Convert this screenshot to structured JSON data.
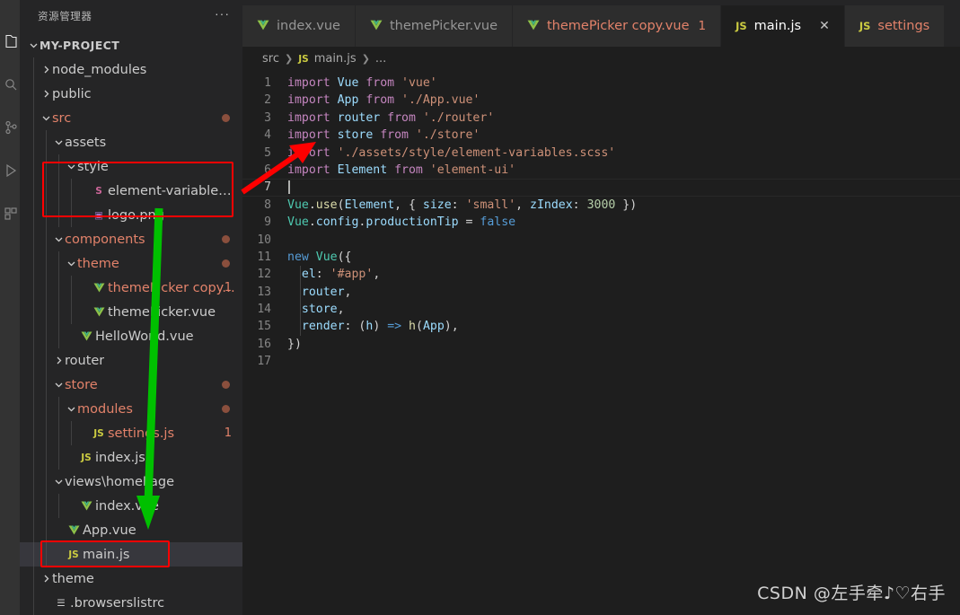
{
  "colors": {
    "accent_red": "#fe0000",
    "accent_green": "#00c000",
    "modified_file": "#e2826a",
    "editor_bg": "#1e1e1e",
    "sidebar_bg": "#252526",
    "tab_inactive_bg": "#2d2d2d"
  },
  "activity_bar": {
    "items": [
      {
        "name": "explorer-icon",
        "glyph": "files"
      },
      {
        "name": "search-icon",
        "glyph": "search"
      },
      {
        "name": "source-control-icon",
        "glyph": "branch"
      },
      {
        "name": "run-debug-icon",
        "glyph": "play"
      },
      {
        "name": "extensions-icon",
        "glyph": "blocks"
      }
    ]
  },
  "sidebar": {
    "title": "资源管理器",
    "more_actions": "···",
    "tree": [
      {
        "label": "MY-PROJECT",
        "kind": "root",
        "twisty": "down",
        "indent": 0,
        "color": "root"
      },
      {
        "label": "node_modules",
        "kind": "folder",
        "twisty": "right",
        "indent": 1,
        "color": "norm"
      },
      {
        "label": "public",
        "kind": "folder",
        "twisty": "right",
        "indent": 1,
        "color": "norm"
      },
      {
        "label": "src",
        "kind": "folder",
        "twisty": "down",
        "indent": 1,
        "color": "mod",
        "dot": true
      },
      {
        "label": "assets",
        "kind": "folder",
        "twisty": "down",
        "indent": 2,
        "color": "norm"
      },
      {
        "label": "style",
        "kind": "folder",
        "twisty": "down",
        "indent": 3,
        "color": "norm"
      },
      {
        "label": "element-variables.scss",
        "kind": "scss",
        "icon": "S",
        "indent": 4,
        "color": "norm"
      },
      {
        "label": "logo.png",
        "kind": "image",
        "icon": "▣",
        "indent": 4,
        "color": "norm"
      },
      {
        "label": "components",
        "kind": "folder",
        "twisty": "down",
        "indent": 2,
        "color": "mod",
        "dot": true
      },
      {
        "label": "theme",
        "kind": "folder",
        "twisty": "down",
        "indent": 3,
        "color": "mod",
        "dot": true
      },
      {
        "label": "themePicker copy.vue",
        "kind": "vue",
        "icon": "V",
        "indent": 4,
        "color": "mod",
        "count": "1"
      },
      {
        "label": "themePicker.vue",
        "kind": "vue",
        "icon": "V",
        "indent": 4,
        "color": "norm"
      },
      {
        "label": "HelloWorld.vue",
        "kind": "vue",
        "icon": "V",
        "indent": 3,
        "color": "norm"
      },
      {
        "label": "router",
        "kind": "folder",
        "twisty": "right",
        "indent": 2,
        "color": "norm"
      },
      {
        "label": "store",
        "kind": "folder",
        "twisty": "down",
        "indent": 2,
        "color": "mod",
        "dot": true
      },
      {
        "label": "modules",
        "kind": "folder",
        "twisty": "down",
        "indent": 3,
        "color": "mod",
        "dot": true
      },
      {
        "label": "settings.js",
        "kind": "js",
        "icon": "JS",
        "indent": 4,
        "color": "mod",
        "count": "1"
      },
      {
        "label": "index.js",
        "kind": "js",
        "icon": "JS",
        "indent": 3,
        "color": "norm"
      },
      {
        "label": "views\\homePage",
        "kind": "folder",
        "twisty": "down",
        "indent": 2,
        "color": "norm"
      },
      {
        "label": "index.vue",
        "kind": "vue",
        "icon": "V",
        "indent": 3,
        "color": "norm"
      },
      {
        "label": "App.vue",
        "kind": "vue",
        "icon": "V",
        "indent": 2,
        "color": "norm"
      },
      {
        "label": "main.js",
        "kind": "js",
        "icon": "JS",
        "indent": 2,
        "color": "norm",
        "selected": true
      },
      {
        "label": "theme",
        "kind": "folder",
        "twisty": "right",
        "indent": 1,
        "color": "norm"
      },
      {
        "label": ".browserslistrc",
        "kind": "text",
        "icon": "☰",
        "indent": 1,
        "color": "norm"
      }
    ]
  },
  "tabs": [
    {
      "label": "index.vue",
      "icon": "V",
      "icon_kind": "vue",
      "active": false,
      "modified": false
    },
    {
      "label": "themePicker.vue",
      "icon": "V",
      "icon_kind": "vue",
      "active": false,
      "modified": false
    },
    {
      "label": "themePicker copy.vue",
      "icon": "V",
      "icon_kind": "vue",
      "active": false,
      "modified": true,
      "count": "1"
    },
    {
      "label": "main.js",
      "icon": "JS",
      "icon_kind": "js",
      "active": true,
      "modified": false,
      "close": "✕"
    },
    {
      "label": "settings",
      "icon": "JS",
      "icon_kind": "js",
      "active": false,
      "modified": true
    }
  ],
  "breadcrumb": {
    "part1": "src",
    "sep": "❯",
    "file_icon": "JS",
    "file": "main.js",
    "sep2": "❯",
    "ellipsis": "..."
  },
  "editor": {
    "filename": "main.js",
    "cursor_line": 7,
    "lines": [
      {
        "n": "1",
        "tokens": [
          {
            "t": "import ",
            "c": "kw"
          },
          {
            "t": "Vue",
            "c": "var"
          },
          {
            "t": " from ",
            "c": "kw"
          },
          {
            "t": "'vue'",
            "c": "str"
          }
        ]
      },
      {
        "n": "2",
        "tokens": [
          {
            "t": "import ",
            "c": "kw"
          },
          {
            "t": "App",
            "c": "var"
          },
          {
            "t": " from ",
            "c": "kw"
          },
          {
            "t": "'./App.vue'",
            "c": "str"
          }
        ]
      },
      {
        "n": "3",
        "tokens": [
          {
            "t": "import ",
            "c": "kw"
          },
          {
            "t": "router",
            "c": "var"
          },
          {
            "t": " from ",
            "c": "kw"
          },
          {
            "t": "'./router'",
            "c": "str"
          }
        ]
      },
      {
        "n": "4",
        "tokens": [
          {
            "t": "import ",
            "c": "kw"
          },
          {
            "t": "store",
            "c": "var"
          },
          {
            "t": " from ",
            "c": "kw"
          },
          {
            "t": "'./store'",
            "c": "str"
          }
        ]
      },
      {
        "n": "5",
        "tokens": [
          {
            "t": "import ",
            "c": "kw"
          },
          {
            "t": "'./assets/style/element-variables.scss'",
            "c": "str"
          }
        ]
      },
      {
        "n": "6",
        "tokens": [
          {
            "t": "import ",
            "c": "kw"
          },
          {
            "t": "Element",
            "c": "var"
          },
          {
            "t": " from ",
            "c": "kw"
          },
          {
            "t": "'element-ui'",
            "c": "str"
          }
        ]
      },
      {
        "n": "7",
        "tokens": [],
        "cursor": true
      },
      {
        "n": "8",
        "tokens": [
          {
            "t": "Vue",
            "c": "obj"
          },
          {
            "t": ".",
            "c": "plain"
          },
          {
            "t": "use",
            "c": "fn"
          },
          {
            "t": "(",
            "c": "plain"
          },
          {
            "t": "Element",
            "c": "var"
          },
          {
            "t": ", { ",
            "c": "plain"
          },
          {
            "t": "size",
            "c": "var"
          },
          {
            "t": ": ",
            "c": "plain"
          },
          {
            "t": "'small'",
            "c": "str"
          },
          {
            "t": ", ",
            "c": "plain"
          },
          {
            "t": "zIndex",
            "c": "var"
          },
          {
            "t": ": ",
            "c": "plain"
          },
          {
            "t": "3000",
            "c": "num"
          },
          {
            "t": " })",
            "c": "plain"
          }
        ]
      },
      {
        "n": "9",
        "tokens": [
          {
            "t": "Vue",
            "c": "obj"
          },
          {
            "t": ".",
            "c": "plain"
          },
          {
            "t": "config",
            "c": "var"
          },
          {
            "t": ".",
            "c": "plain"
          },
          {
            "t": "productionTip",
            "c": "var"
          },
          {
            "t": " = ",
            "c": "plain"
          },
          {
            "t": "false",
            "c": "blue"
          }
        ]
      },
      {
        "n": "10",
        "tokens": []
      },
      {
        "n": "11",
        "tokens": [
          {
            "t": "new ",
            "c": "blue"
          },
          {
            "t": "Vue",
            "c": "obj"
          },
          {
            "t": "({",
            "c": "plain"
          }
        ]
      },
      {
        "n": "12",
        "tokens": [
          {
            "t": "  ",
            "c": "plain"
          },
          {
            "t": "el",
            "c": "var"
          },
          {
            "t": ": ",
            "c": "plain"
          },
          {
            "t": "'#app'",
            "c": "str"
          },
          {
            "t": ",",
            "c": "plain"
          }
        ]
      },
      {
        "n": "13",
        "tokens": [
          {
            "t": "  ",
            "c": "plain"
          },
          {
            "t": "router",
            "c": "var"
          },
          {
            "t": ",",
            "c": "plain"
          }
        ]
      },
      {
        "n": "14",
        "tokens": [
          {
            "t": "  ",
            "c": "plain"
          },
          {
            "t": "store",
            "c": "var"
          },
          {
            "t": ",",
            "c": "plain"
          }
        ]
      },
      {
        "n": "15",
        "tokens": [
          {
            "t": "  ",
            "c": "plain"
          },
          {
            "t": "render",
            "c": "var"
          },
          {
            "t": ": (",
            "c": "plain"
          },
          {
            "t": "h",
            "c": "var"
          },
          {
            "t": ") ",
            "c": "plain"
          },
          {
            "t": "=>",
            "c": "blue"
          },
          {
            "t": " ",
            "c": "plain"
          },
          {
            "t": "h",
            "c": "fn"
          },
          {
            "t": "(",
            "c": "plain"
          },
          {
            "t": "App",
            "c": "var"
          },
          {
            "t": "),",
            "c": "plain"
          }
        ]
      },
      {
        "n": "16",
        "tokens": [
          {
            "t": "})",
            "c": "plain"
          }
        ]
      },
      {
        "n": "17",
        "tokens": []
      }
    ]
  },
  "annotations": {
    "red_box_style": "Red rectangle highlighting style folder and element-variables.scss",
    "red_box_main": "Red rectangle highlighting main.js in explorer",
    "red_arrow": "Red arrow pointing at the scss import on line 5",
    "green_arrow": "Green arrow from assets/style down to main.js"
  },
  "watermark": "CSDN @左手牵♪♡右手"
}
